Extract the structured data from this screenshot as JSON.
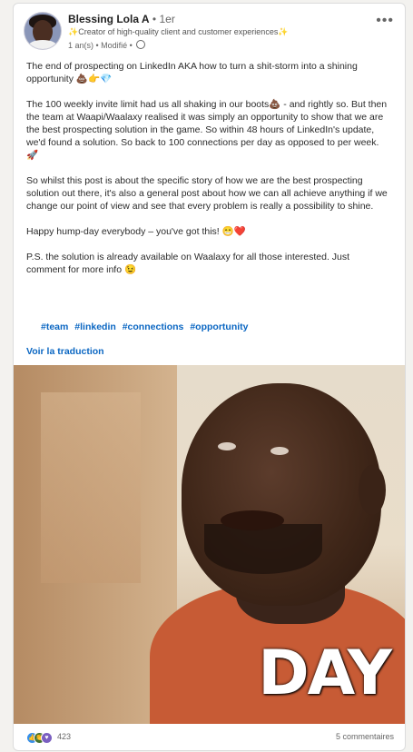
{
  "author": {
    "name": "Blessing Lola A",
    "degree": "1er",
    "headline": "✨Creator of high-quality client and customer experiences✨",
    "meta": "1 an(s) • Modifié •"
  },
  "post": {
    "paragraphs": [
      "The end of prospecting on LinkedIn AKA how to turn a shit-storm into a shining opportunity 💩👉💎",
      "The 100 weekly invite limit had us all shaking in our boots💩 - and rightly so. But then the team at Waapi/Waalaxy realised it was simply an opportunity to show that we are the best prospecting solution in the game. So within 48 hours of LinkedIn's update, we'd found a solution. So back to 100 connections per day as opposed to per week. 🚀",
      "So whilst this post is about the specific story of how we are the best prospecting solution out there, it's also a general post about how we can all achieve anything if we change our point of view and see that every problem is really a possibility to shine.",
      "Happy hump-day everybody – you've got this! 😁❤️",
      "P.S. the solution is already available on Waalaxy for all those interested. Just comment for more info 😉"
    ],
    "hashtags": [
      "#team",
      "#linkedin",
      "#connections",
      "#opportunity"
    ],
    "translate_label": "Voir la traduction"
  },
  "media": {
    "overlay_text": "DAY"
  },
  "footer": {
    "reaction_count": "423",
    "comments_label": "5 commentaires"
  },
  "icons": {
    "more": "more-options-icon",
    "visibility": "globe-icon",
    "reactions": [
      "like-icon",
      "celebrate-icon",
      "support-icon"
    ]
  }
}
